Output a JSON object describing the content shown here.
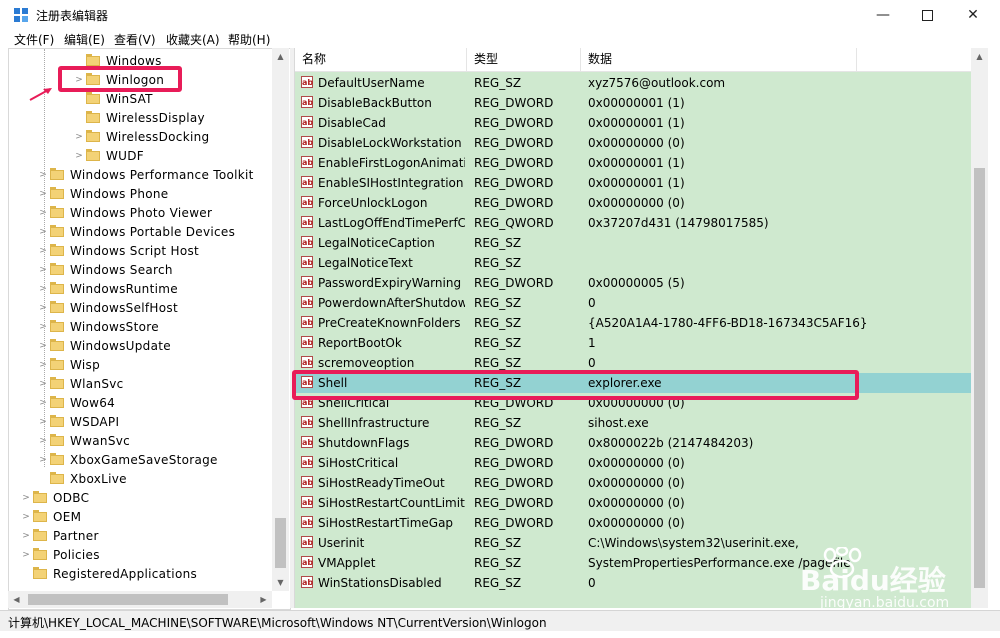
{
  "window": {
    "title": "注册表编辑器"
  },
  "menu": [
    "文件(F)",
    "编辑(E)",
    "查看(V)",
    "收藏夹(A)",
    "帮助(H)"
  ],
  "tree": [
    {
      "label": "Windows",
      "level": 2,
      "arrow": ""
    },
    {
      "label": "Winlogon",
      "level": 2,
      "arrow": ">"
    },
    {
      "label": "WinSAT",
      "level": 2,
      "arrow": ""
    },
    {
      "label": "WirelessDisplay",
      "level": 2,
      "arrow": ""
    },
    {
      "label": "WirelessDocking",
      "level": 2,
      "arrow": ">"
    },
    {
      "label": "WUDF",
      "level": 2,
      "arrow": ">"
    },
    {
      "label": "Windows Performance Toolkit",
      "level": 1,
      "arrow": ">"
    },
    {
      "label": "Windows Phone",
      "level": 1,
      "arrow": ">"
    },
    {
      "label": "Windows Photo Viewer",
      "level": 1,
      "arrow": ">"
    },
    {
      "label": "Windows Portable Devices",
      "level": 1,
      "arrow": ">"
    },
    {
      "label": "Windows Script Host",
      "level": 1,
      "arrow": ">"
    },
    {
      "label": "Windows Search",
      "level": 1,
      "arrow": ">"
    },
    {
      "label": "WindowsRuntime",
      "level": 1,
      "arrow": ">"
    },
    {
      "label": "WindowsSelfHost",
      "level": 1,
      "arrow": ">"
    },
    {
      "label": "WindowsStore",
      "level": 1,
      "arrow": ">"
    },
    {
      "label": "WindowsUpdate",
      "level": 1,
      "arrow": ">"
    },
    {
      "label": "Wisp",
      "level": 1,
      "arrow": ">"
    },
    {
      "label": "WlanSvc",
      "level": 1,
      "arrow": ">"
    },
    {
      "label": "Wow64",
      "level": 1,
      "arrow": ">"
    },
    {
      "label": "WSDAPI",
      "level": 1,
      "arrow": ">"
    },
    {
      "label": "WwanSvc",
      "level": 1,
      "arrow": ">"
    },
    {
      "label": "XboxGameSaveStorage",
      "level": 1,
      "arrow": ">"
    },
    {
      "label": "XboxLive",
      "level": 1,
      "arrow": ""
    },
    {
      "label": "ODBC",
      "level": 0,
      "arrow": ">"
    },
    {
      "label": "OEM",
      "level": 0,
      "arrow": ">"
    },
    {
      "label": "Partner",
      "level": 0,
      "arrow": ">"
    },
    {
      "label": "Policies",
      "level": 0,
      "arrow": ">"
    },
    {
      "label": "RegisteredApplications",
      "level": 0,
      "arrow": ""
    }
  ],
  "columns": [
    "名称",
    "类型",
    "数据"
  ],
  "rows": [
    {
      "name": "DefaultUserName",
      "type": "REG_SZ",
      "data": "xyz7576@outlook.com"
    },
    {
      "name": "DisableBackButton",
      "type": "REG_DWORD",
      "data": "0x00000001 (1)"
    },
    {
      "name": "DisableCad",
      "type": "REG_DWORD",
      "data": "0x00000001 (1)"
    },
    {
      "name": "DisableLockWorkstation",
      "type": "REG_DWORD",
      "data": "0x00000000 (0)"
    },
    {
      "name": "EnableFirstLogonAnimati...",
      "type": "REG_DWORD",
      "data": "0x00000001 (1)"
    },
    {
      "name": "EnableSIHostIntegration",
      "type": "REG_DWORD",
      "data": "0x00000001 (1)"
    },
    {
      "name": "ForceUnlockLogon",
      "type": "REG_DWORD",
      "data": "0x00000000 (0)"
    },
    {
      "name": "LastLogOffEndTimePerfC...",
      "type": "REG_QWORD",
      "data": "0x37207d431 (14798017585)"
    },
    {
      "name": "LegalNoticeCaption",
      "type": "REG_SZ",
      "data": ""
    },
    {
      "name": "LegalNoticeText",
      "type": "REG_SZ",
      "data": ""
    },
    {
      "name": "PasswordExpiryWarning",
      "type": "REG_DWORD",
      "data": "0x00000005 (5)"
    },
    {
      "name": "PowerdownAfterShutdown",
      "type": "REG_SZ",
      "data": "0"
    },
    {
      "name": "PreCreateKnownFolders",
      "type": "REG_SZ",
      "data": "{A520A1A4-1780-4FF6-BD18-167343C5AF16}"
    },
    {
      "name": "ReportBootOk",
      "type": "REG_SZ",
      "data": "1"
    },
    {
      "name": "scremoveoption",
      "type": "REG_SZ",
      "data": "0"
    },
    {
      "name": "Shell",
      "type": "REG_SZ",
      "data": "explorer.exe",
      "selected": true
    },
    {
      "name": "ShellCritical",
      "type": "REG_DWORD",
      "data": "0x00000000 (0)"
    },
    {
      "name": "ShellInfrastructure",
      "type": "REG_SZ",
      "data": "sihost.exe"
    },
    {
      "name": "ShutdownFlags",
      "type": "REG_DWORD",
      "data": "0x8000022b (2147484203)"
    },
    {
      "name": "SiHostCritical",
      "type": "REG_DWORD",
      "data": "0x00000000 (0)"
    },
    {
      "name": "SiHostReadyTimeOut",
      "type": "REG_DWORD",
      "data": "0x00000000 (0)"
    },
    {
      "name": "SiHostRestartCountLimit",
      "type": "REG_DWORD",
      "data": "0x00000000 (0)"
    },
    {
      "name": "SiHostRestartTimeGap",
      "type": "REG_DWORD",
      "data": "0x00000000 (0)"
    },
    {
      "name": "Userinit",
      "type": "REG_SZ",
      "data": "C:\\Windows\\system32\\userinit.exe,"
    },
    {
      "name": "VMApplet",
      "type": "REG_SZ",
      "data": "SystemPropertiesPerformance.exe /pagefile"
    },
    {
      "name": "WinStationsDisabled",
      "type": "REG_SZ",
      "data": "0"
    }
  ],
  "status": {
    "path": "计算机\\HKEY_LOCAL_MACHINE\\SOFTWARE\\Microsoft\\Windows NT\\CurrentVersion\\Winlogon"
  },
  "watermark": {
    "brand": "Baidu经验",
    "url": "jingyan.baidu.com"
  },
  "colors": {
    "list_bg": "#cfe9cf",
    "selected_row": "#93d2d2",
    "highlight": "#e81c58"
  },
  "icons": {
    "value_icon": "ab",
    "folder": "folder-icon"
  }
}
